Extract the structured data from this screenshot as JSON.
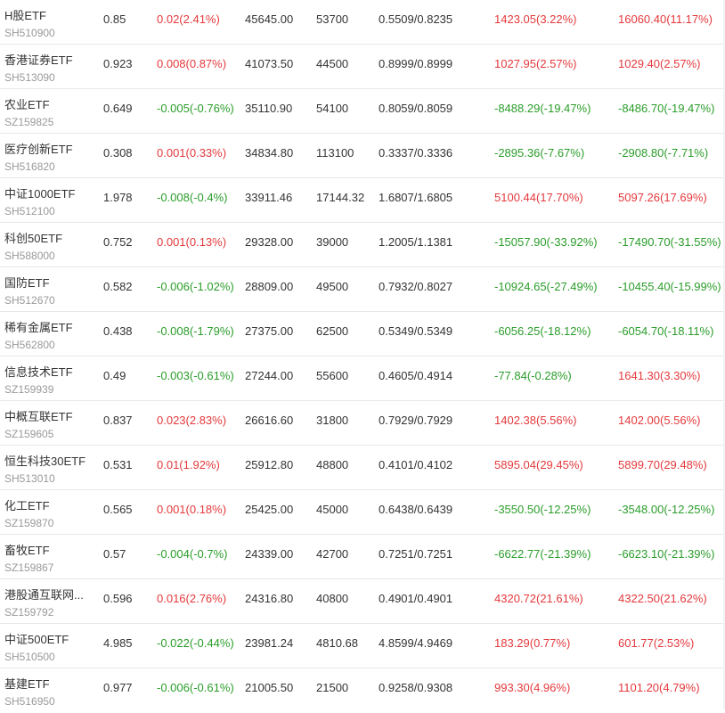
{
  "rows": [
    {
      "name": "H股ETF",
      "code": "SH510900",
      "price": "0.85",
      "change": "0.02(2.41%)",
      "change_dir": "up",
      "v1": "45645.00",
      "v2": "53700",
      "v3": "0.5509/0.8235",
      "v4": "1423.05(3.22%)",
      "v4_dir": "up",
      "v5": "16060.40(11.17%)",
      "v5_dir": "up"
    },
    {
      "name": "香港证券ETF",
      "code": "SH513090",
      "price": "0.923",
      "change": "0.008(0.87%)",
      "change_dir": "up",
      "v1": "41073.50",
      "v2": "44500",
      "v3": "0.8999/0.8999",
      "v4": "1027.95(2.57%)",
      "v4_dir": "up",
      "v5": "1029.40(2.57%)",
      "v5_dir": "up"
    },
    {
      "name": "农业ETF",
      "code": "SZ159825",
      "price": "0.649",
      "change": "-0.005(-0.76%)",
      "change_dir": "down",
      "v1": "35110.90",
      "v2": "54100",
      "v3": "0.8059/0.8059",
      "v4": "-8488.29(-19.47%)",
      "v4_dir": "down",
      "v5": "-8486.70(-19.47%)",
      "v5_dir": "down"
    },
    {
      "name": "医疗创新ETF",
      "code": "SH516820",
      "price": "0.308",
      "change": "0.001(0.33%)",
      "change_dir": "up",
      "v1": "34834.80",
      "v2": "113100",
      "v3": "0.3337/0.3336",
      "v4": "-2895.36(-7.67%)",
      "v4_dir": "down",
      "v5": "-2908.80(-7.71%)",
      "v5_dir": "down"
    },
    {
      "name": "中证1000ETF",
      "code": "SH512100",
      "price": "1.978",
      "change": "-0.008(-0.4%)",
      "change_dir": "down",
      "v1": "33911.46",
      "v2": "17144.32",
      "v3": "1.6807/1.6805",
      "v4": "5100.44(17.70%)",
      "v4_dir": "up",
      "v5": "5097.26(17.69%)",
      "v5_dir": "up"
    },
    {
      "name": "科创50ETF",
      "code": "SH588000",
      "price": "0.752",
      "change": "0.001(0.13%)",
      "change_dir": "up",
      "v1": "29328.00",
      "v2": "39000",
      "v3": "1.2005/1.1381",
      "v4": "-15057.90(-33.92%)",
      "v4_dir": "down",
      "v5": "-17490.70(-31.55%)",
      "v5_dir": "down"
    },
    {
      "name": "国防ETF",
      "code": "SH512670",
      "price": "0.582",
      "change": "-0.006(-1.02%)",
      "change_dir": "down",
      "v1": "28809.00",
      "v2": "49500",
      "v3": "0.7932/0.8027",
      "v4": "-10924.65(-27.49%)",
      "v4_dir": "down",
      "v5": "-10455.40(-15.99%)",
      "v5_dir": "down"
    },
    {
      "name": "稀有金属ETF",
      "code": "SH562800",
      "price": "0.438",
      "change": "-0.008(-1.79%)",
      "change_dir": "down",
      "v1": "27375.00",
      "v2": "62500",
      "v3": "0.5349/0.5349",
      "v4": "-6056.25(-18.12%)",
      "v4_dir": "down",
      "v5": "-6054.70(-18.11%)",
      "v5_dir": "down"
    },
    {
      "name": "信息技术ETF",
      "code": "SZ159939",
      "price": "0.49",
      "change": "-0.003(-0.61%)",
      "change_dir": "down",
      "v1": "27244.00",
      "v2": "55600",
      "v3": "0.4605/0.4914",
      "v4": "-77.84(-0.28%)",
      "v4_dir": "down",
      "v5": "1641.30(3.30%)",
      "v5_dir": "up"
    },
    {
      "name": "中概互联ETF",
      "code": "SZ159605",
      "price": "0.837",
      "change": "0.023(2.83%)",
      "change_dir": "up",
      "v1": "26616.60",
      "v2": "31800",
      "v3": "0.7929/0.7929",
      "v4": "1402.38(5.56%)",
      "v4_dir": "up",
      "v5": "1402.00(5.56%)",
      "v5_dir": "up"
    },
    {
      "name": "恒生科技30ETF",
      "code": "SH513010",
      "price": "0.531",
      "change": "0.01(1.92%)",
      "change_dir": "up",
      "v1": "25912.80",
      "v2": "48800",
      "v3": "0.4101/0.4102",
      "v4": "5895.04(29.45%)",
      "v4_dir": "up",
      "v5": "5899.70(29.48%)",
      "v5_dir": "up"
    },
    {
      "name": "化工ETF",
      "code": "SZ159870",
      "price": "0.565",
      "change": "0.001(0.18%)",
      "change_dir": "up",
      "v1": "25425.00",
      "v2": "45000",
      "v3": "0.6438/0.6439",
      "v4": "-3550.50(-12.25%)",
      "v4_dir": "down",
      "v5": "-3548.00(-12.25%)",
      "v5_dir": "down"
    },
    {
      "name": "畜牧ETF",
      "code": "SZ159867",
      "price": "0.57",
      "change": "-0.004(-0.7%)",
      "change_dir": "down",
      "v1": "24339.00",
      "v2": "42700",
      "v3": "0.7251/0.7251",
      "v4": "-6622.77(-21.39%)",
      "v4_dir": "down",
      "v5": "-6623.10(-21.39%)",
      "v5_dir": "down"
    },
    {
      "name": "港股通互联网...",
      "code": "SZ159792",
      "price": "0.596",
      "change": "0.016(2.76%)",
      "change_dir": "up",
      "v1": "24316.80",
      "v2": "40800",
      "v3": "0.4901/0.4901",
      "v4": "4320.72(21.61%)",
      "v4_dir": "up",
      "v5": "4322.50(21.62%)",
      "v5_dir": "up"
    },
    {
      "name": "中证500ETF",
      "code": "SH510500",
      "price": "4.985",
      "change": "-0.022(-0.44%)",
      "change_dir": "down",
      "v1": "23981.24",
      "v2": "4810.68",
      "v3": "4.8599/4.9469",
      "v4": "183.29(0.77%)",
      "v4_dir": "up",
      "v5": "601.77(2.53%)",
      "v5_dir": "up"
    },
    {
      "name": "基建ETF",
      "code": "SH516950",
      "price": "0.977",
      "change": "-0.006(-0.61%)",
      "change_dir": "down",
      "v1": "21005.50",
      "v2": "21500",
      "v3": "0.9258/0.9308",
      "v4": "993.30(4.96%)",
      "v4_dir": "up",
      "v5": "1101.20(4.79%)",
      "v5_dir": "up"
    }
  ]
}
